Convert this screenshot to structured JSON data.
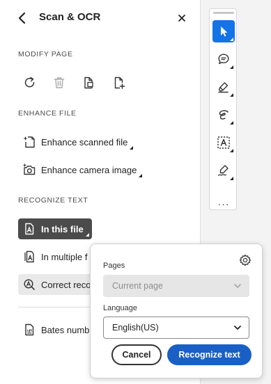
{
  "header": {
    "title": "Scan & OCR"
  },
  "sections": {
    "modify_page": "MODIFY PAGE",
    "enhance_file": "ENHANCE FILE",
    "recognize_text": "RECOGNIZE TEXT"
  },
  "modify_tools": [
    {
      "icon": "rotate-icon"
    },
    {
      "icon": "delete-icon",
      "disabled": true
    },
    {
      "icon": "extract-page-icon"
    },
    {
      "icon": "insert-page-icon"
    }
  ],
  "enhance_items": [
    {
      "label": "Enhance scanned file",
      "icon": "scan-sparkle-icon"
    },
    {
      "label": "Enhance camera image",
      "icon": "camera-sparkle-icon"
    }
  ],
  "recognize_items": [
    {
      "label": "In this file",
      "icon": "ocr-document-icon",
      "selected": true
    },
    {
      "label": "In multiple f",
      "icon": "multiple-files-ocr-icon"
    },
    {
      "label": "Correct reco",
      "icon": "correct-recognized-text-icon"
    }
  ],
  "bates": {
    "label": "Bates numb",
    "icon": "bates-numbering-icon"
  },
  "toolbar": {
    "items": [
      "select-cursor-icon",
      "comment-icon",
      "highlight-icon",
      "draw-icon",
      "text-recognition-icon",
      "signature-icon"
    ],
    "more": "···"
  },
  "popover": {
    "pages_label": "Pages",
    "pages_value": "Current page",
    "language_label": "Language",
    "language_value": "English(US)",
    "cancel_label": "Cancel",
    "primary_label": "Recognize text"
  },
  "colors": {
    "accent": "#1473e6",
    "primary_button": "#1a5fc6",
    "selected_row": "#4b4b4b"
  }
}
